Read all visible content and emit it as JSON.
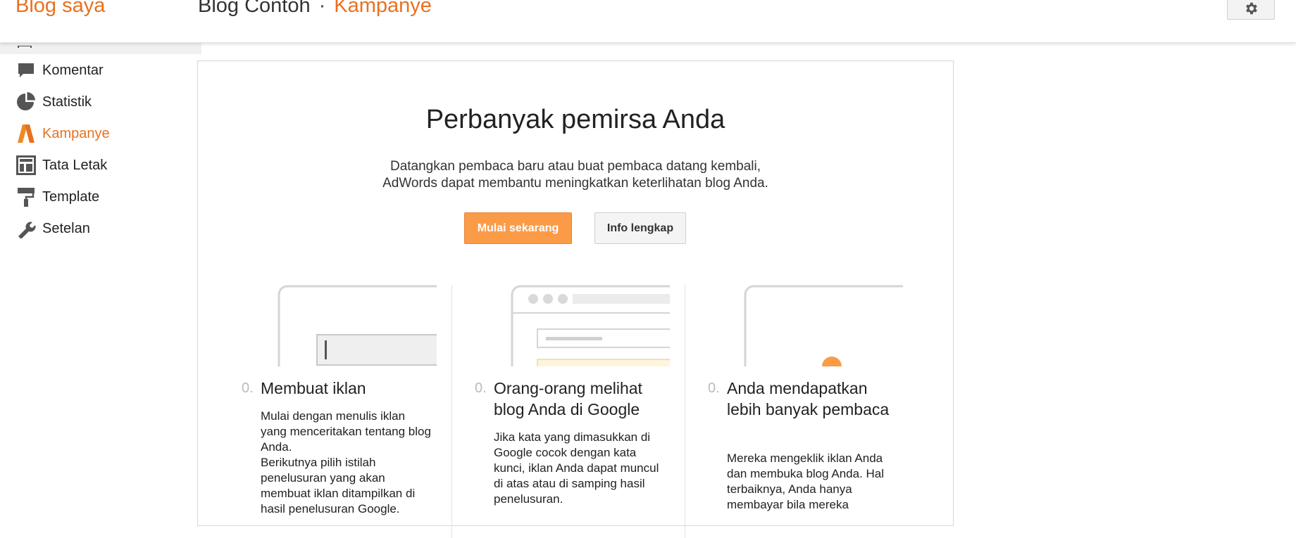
{
  "header": {
    "brand": "Blog saya",
    "blog_name": "Blog Contoh",
    "separator": "·",
    "section": "Kampanye"
  },
  "sidebar": {
    "items": [
      {
        "label": "Komentar",
        "icon": "comment-icon"
      },
      {
        "label": "Statistik",
        "icon": "pie-chart-icon"
      },
      {
        "label": "Kampanye",
        "icon": "adwords-icon",
        "active": true
      },
      {
        "label": "Tata Letak",
        "icon": "layout-icon"
      },
      {
        "label": "Template",
        "icon": "paint-roller-icon"
      },
      {
        "label": "Setelan",
        "icon": "wrench-icon"
      }
    ]
  },
  "main": {
    "headline": "Perbanyak pemirsa Anda",
    "subtitle_line1": "Datangkan pembaca baru atau buat pembaca datang kembali,",
    "subtitle_line2": "AdWords dapat membantu meningkatkan keterlihatan blog Anda.",
    "start_button": "Mulai sekarang",
    "info_button": "Info lengkap",
    "steps": [
      {
        "number": "0.",
        "title": "Membuat iklan",
        "body": "Mulai dengan menulis iklan yang menceritakan tentang blog Anda.\nBerikutnya pilih istilah penelusuran yang akan membuat iklan ditampilkan di hasil penelusuran Google."
      },
      {
        "number": "0.",
        "title": "Orang-orang melihat blog Anda di Google",
        "body": "Jika kata yang dimasukkan di Google cocok dengan kata kunci, iklan Anda dapat muncul di atas atau di samping hasil penelusuran."
      },
      {
        "number": "0.",
        "title": "Anda mendapatkan lebih banyak pembaca",
        "body": "Mereka mengeklik iklan Anda dan membuka blog Anda. Hal terbaiknya, Anda hanya membayar bila mereka"
      }
    ]
  },
  "colors": {
    "accent": "#e8711f",
    "button_primary": "#fb9b47"
  }
}
